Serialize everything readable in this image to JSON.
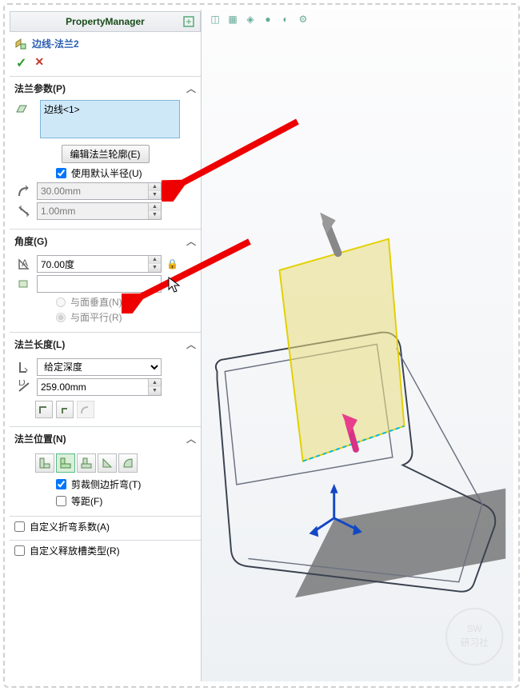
{
  "header": {
    "title": "PropertyManager"
  },
  "feature": {
    "name": "边线-法兰2"
  },
  "sections": {
    "flangeParams": {
      "title": "法兰参数(P)",
      "selectedEdge": "边线<1>",
      "editProfileBtn": "编辑法兰轮廓(E)",
      "useDefaultRadius": {
        "label": "使用默认半径(U)",
        "checked": true
      },
      "radius": "30.00mm",
      "gap": "1.00mm"
    },
    "angle": {
      "title": "角度(G)",
      "value": "70.00度",
      "refFace": "",
      "perpendicular": {
        "label": "与面垂直(N)",
        "checked": false
      },
      "parallel": {
        "label": "与面平行(R)",
        "checked": true
      }
    },
    "length": {
      "title": "法兰长度(L)",
      "endCondition": "给定深度",
      "value": "259.00mm"
    },
    "position": {
      "title": "法兰位置(N)",
      "trimSideBends": {
        "label": "剪裁侧边折弯(T)",
        "checked": true
      },
      "offset": {
        "label": "等距(F)",
        "checked": false
      }
    },
    "customBend": {
      "label": "自定义折弯系数(A)",
      "checked": false
    },
    "customRelief": {
      "label": "自定义释放槽类型(R)",
      "checked": false
    }
  }
}
